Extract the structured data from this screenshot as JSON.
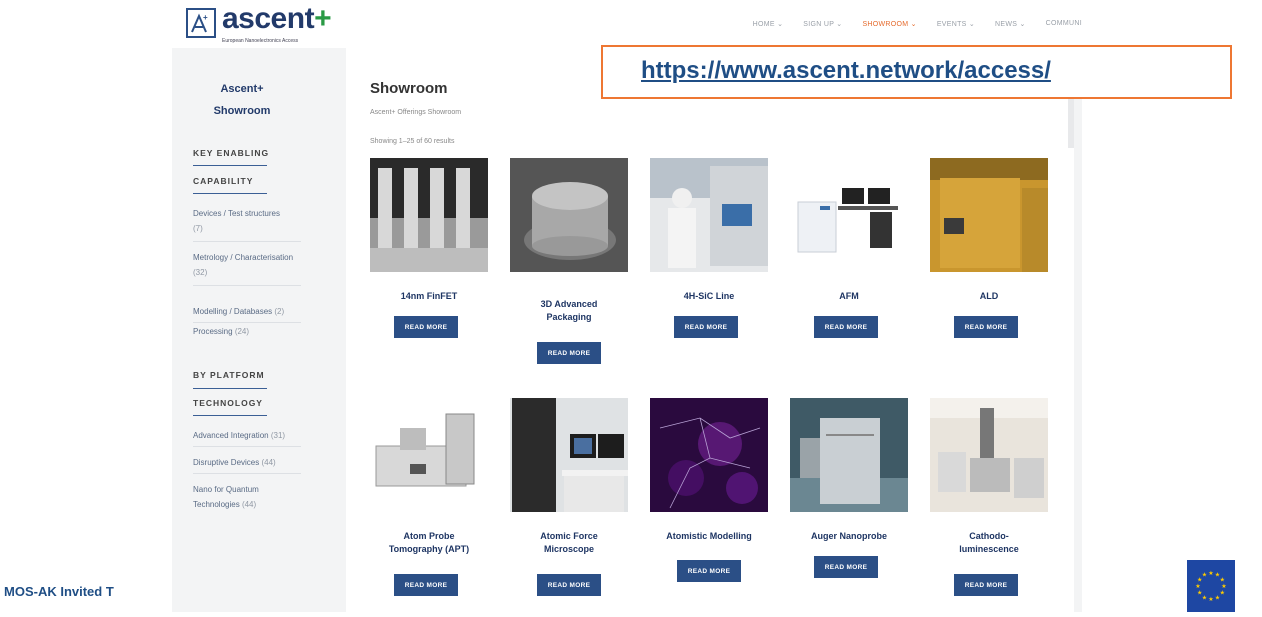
{
  "header": {
    "logo_text": "ascent",
    "logo_plus": "+",
    "logo_subtitle": "European Nanoelectronics Access",
    "nav": [
      {
        "label": "HOME ⌄"
      },
      {
        "label": "SIGN UP ⌄"
      },
      {
        "label": "SHOWROOM ⌄"
      },
      {
        "label": "EVENTS ⌄"
      },
      {
        "label": "NEWS ⌄"
      },
      {
        "label": "COMMUNI"
      }
    ],
    "active_nav": "SHOWROOM"
  },
  "sidebar": {
    "title_line1": "Ascent+",
    "title_line2": "Showroom",
    "section1_line1": "KEY ENABLING",
    "section1_line2": "CAPABILITY",
    "section1_items": [
      {
        "label": "Devices / Test structures",
        "count": "(7)"
      },
      {
        "label": "Metrology / Characterisation",
        "count": "(32)"
      },
      {
        "label": "Modelling / Databases",
        "count": "(2)"
      },
      {
        "label": "Processing",
        "count": "(24)"
      }
    ],
    "section2_line1": "BY PLATFORM",
    "section2_line2": "TECHNOLOGY",
    "section2_items": [
      {
        "label": "Advanced Integration",
        "count": "(31)"
      },
      {
        "label": "Disruptive Devices",
        "count": "(44)"
      },
      {
        "label": "Nano for Quantum Technologies",
        "count": "(44)"
      }
    ]
  },
  "main": {
    "title": "Showroom",
    "subtitle": "Ascent+ Offerings Showroom",
    "result_count": "Showing 1–25 of 60 results",
    "read_more_label": "READ MORE",
    "cards": [
      {
        "line1": "14nm FinFET",
        "line2": ""
      },
      {
        "line1": "3D Advanced",
        "line2": "Packaging"
      },
      {
        "line1": "4H-SiC Line",
        "line2": ""
      },
      {
        "line1": "AFM",
        "line2": ""
      },
      {
        "line1": "ALD",
        "line2": ""
      },
      {
        "line1": "Atom Probe",
        "line2": "Tomography (APT)"
      },
      {
        "line1": "Atomic Force",
        "line2": "Microscope"
      },
      {
        "line1": "Atomistic Modelling",
        "line2": ""
      },
      {
        "line1": "Auger Nanoprobe",
        "line2": ""
      },
      {
        "line1": "Cathodo-",
        "line2": "luminescence"
      }
    ]
  },
  "overlay": {
    "url": "https://www.ascent.network/access/"
  },
  "footer": {
    "text": "MOS-AK Invited T"
  },
  "colors": {
    "brand_navy": "#223a6a",
    "button_blue": "#2b4f86",
    "accent_orange": "#e56a2c",
    "url_box_border": "#ee7733",
    "eu_blue": "#1e47a3",
    "eu_star": "#ffcc00"
  }
}
